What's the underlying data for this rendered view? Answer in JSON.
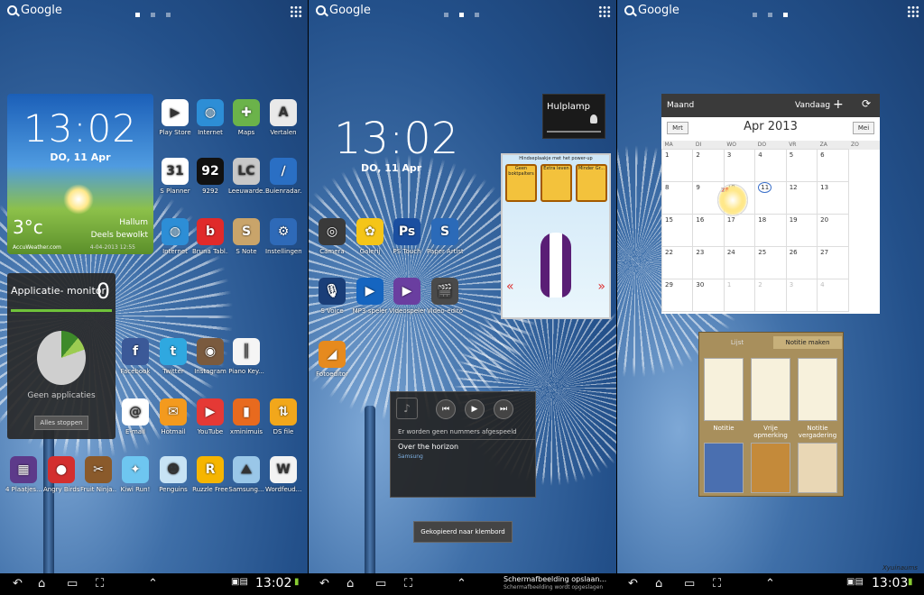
{
  "brand": "Google",
  "screen1": {
    "weather": {
      "time": "13:02",
      "date": "DO, 11 Apr",
      "temp": "3°c",
      "location": "Hallum",
      "condition": "Deels bewolkt",
      "source": "AccuWeather.com",
      "updated": "4-04-2013 12:55"
    },
    "monitor": {
      "title": "Applicatie- monitor",
      "count": "0",
      "empty": "Geen applicaties",
      "button": "Alles stoppen"
    },
    "apps": [
      {
        "label": "Play Store",
        "color": "#ffffff",
        "glyph": "▶"
      },
      {
        "label": "Internet",
        "color": "#2d8ed6",
        "glyph": "◍"
      },
      {
        "label": "Maps",
        "color": "#6bb34a",
        "glyph": "✚"
      },
      {
        "label": "Vertalen",
        "color": "#e9e9e9",
        "glyph": "A"
      },
      {
        "label": "S Planner",
        "color": "#ffffff",
        "glyph": "31"
      },
      {
        "label": "9292",
        "color": "#111111",
        "glyph": "92"
      },
      {
        "label": "Leeuwarde...",
        "color": "#c8c8c8",
        "glyph": "LC"
      },
      {
        "label": "Buienradar...",
        "color": "#2a6fc4",
        "glyph": "∕"
      },
      {
        "label": "Internet",
        "color": "#2d8ed6",
        "glyph": "◍"
      },
      {
        "label": "Bruna Tabl...",
        "color": "#e02a2a",
        "glyph": "b"
      },
      {
        "label": "S Note",
        "color": "#c9a46a",
        "glyph": "S"
      },
      {
        "label": "Instellingen",
        "color": "#2e6ab8",
        "glyph": "⚙"
      },
      {
        "label": "Facebook",
        "color": "#3b5998",
        "glyph": "f"
      },
      {
        "label": "Twitter",
        "color": "#2fa8e0",
        "glyph": "t"
      },
      {
        "label": "Instagram",
        "color": "#7a5a3e",
        "glyph": "◉"
      },
      {
        "label": "Piano Key...",
        "color": "#f5f5f5",
        "glyph": "║"
      },
      {
        "label": "E-mail",
        "color": "#ffffff",
        "glyph": "@"
      },
      {
        "label": "Hotmail",
        "color": "#f39a1e",
        "glyph": "✉"
      },
      {
        "label": "YouTube",
        "color": "#e53935",
        "glyph": "▶"
      },
      {
        "label": "xminimuis",
        "color": "#e86a1e",
        "glyph": "▮"
      },
      {
        "label": "DS file",
        "color": "#f2a71b",
        "glyph": "⇅"
      },
      {
        "label": "4 Plaatjes...",
        "color": "#5d3a8a",
        "glyph": "▦"
      },
      {
        "label": "Angry Birds",
        "color": "#d32f2f",
        "glyph": "●"
      },
      {
        "label": "Fruit Ninja...",
        "color": "#8a5a2b",
        "glyph": "✂"
      },
      {
        "label": "Kiwi Run!",
        "color": "#6ec6f0",
        "glyph": "✦"
      },
      {
        "label": "Penguins",
        "color": "#c7e3f5",
        "glyph": "☻"
      },
      {
        "label": "Ruzzle Free",
        "color": "#f6b500",
        "glyph": "R"
      },
      {
        "label": "Samsung...",
        "color": "#9ac7e8",
        "glyph": "⛰"
      },
      {
        "label": "Wordfeud...",
        "color": "#f3f3f3",
        "glyph": "W"
      }
    ]
  },
  "screen2": {
    "clock": "13:02",
    "date": "DO, 11 Apr",
    "lamp": "Hulplamp",
    "game_cards": [
      "Geen boktpalters",
      "Extra leven",
      "Minder Gr..."
    ],
    "game_banner": "Hindseplaakje met het power-up",
    "apps": [
      {
        "label": "Camera",
        "color": "#3a3a3a",
        "glyph": "◎"
      },
      {
        "label": "Galerij",
        "color": "#f5c518",
        "glyph": "✿"
      },
      {
        "label": "PS Touch",
        "color": "#1b4fa0",
        "glyph": "Ps"
      },
      {
        "label": "Paper Artist",
        "color": "#2b6ab8",
        "glyph": "S"
      },
      {
        "label": "S Voice",
        "color": "#1a3e78",
        "glyph": "🎙"
      },
      {
        "label": "MP3-speler",
        "color": "#1565c0",
        "glyph": "▶"
      },
      {
        "label": "Videospeler",
        "color": "#6a3ea0",
        "glyph": "▶"
      },
      {
        "label": "Video-editor",
        "color": "#4a4a4a",
        "glyph": "🎬"
      },
      {
        "label": "Fotoeditor",
        "color": "#e68a1e",
        "glyph": "◢"
      }
    ],
    "music": {
      "none": "Er worden geen nummers afgespeeld",
      "title": "Over the horizon",
      "artist": "Samsung"
    },
    "toast": "Gekopieerd naar klembord"
  },
  "screen3": {
    "calendar": {
      "view": "Maand",
      "today_btn": "Vandaag",
      "prev": "Mrt",
      "next": "Mei",
      "month": "Apr 2013",
      "days": [
        "MA",
        "DI",
        "WO",
        "DO",
        "VR",
        "ZA",
        "ZO"
      ],
      "weeks": [
        [
          "1",
          "2",
          "3",
          "4",
          "5",
          "6",
          "7"
        ],
        [
          "8",
          "9",
          "10",
          "11",
          "12",
          "13",
          "14"
        ],
        [
          "15",
          "16",
          "17",
          "18",
          "19",
          "20",
          "21"
        ],
        [
          "22",
          "23",
          "24",
          "25",
          "26",
          "27",
          "28"
        ],
        [
          "29",
          "30",
          "1",
          "2",
          "3",
          "4",
          "5"
        ]
      ]
    },
    "memo": {
      "tab1": "Lijst",
      "tab2": "Notitie maken",
      "notes": [
        "Notitie",
        "Vrije opmerking",
        "Notitie vergadering"
      ]
    }
  },
  "status": {
    "time1": "13:02",
    "time3": "13:03",
    "shot_title": "Schermafbeelding opslaan...",
    "shot_sub": "Schermafbeelding wordt opgeslagen"
  },
  "watermark": "Xyuinaums"
}
